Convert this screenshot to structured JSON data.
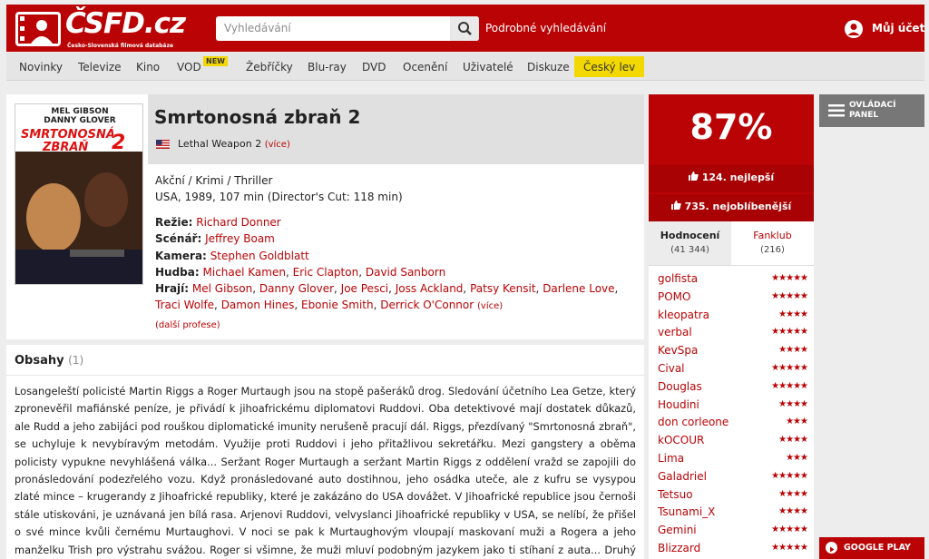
{
  "header": {
    "logo_text": "ČSFD.cz",
    "logo_sub": "Česko-Slovenská filmová databáze",
    "search_placeholder": "Vyhledávání",
    "advanced_search": "Podrobné vyhledávání",
    "account": "Můj účet"
  },
  "nav": {
    "items": [
      "Novinky",
      "Televize",
      "Kino",
      "VOD",
      "Žebříčky",
      "Blu-ray",
      "DVD",
      "Ocenění",
      "Uživatelé",
      "Diskuze",
      "Český lev"
    ],
    "vod_badge": "NEW"
  },
  "film": {
    "title": "Smrtonosná zbraň 2",
    "original_title": "Lethal Weapon 2",
    "more": "(více)",
    "genres": "Akční / Krimi / Thriller",
    "origin": "USA, 1989, 107 min (Director's Cut: 118 min)",
    "poster_actors_1": "MEL GIBSON",
    "poster_actors_2": "DANNY GLOVER",
    "poster_title_1": "SMRTONOSNÁ",
    "poster_title_2": "ZBRAŇ",
    "poster_num": "2",
    "crew": {
      "director_label": "Režie:",
      "director": "Richard Donner",
      "writer_label": "Scénář:",
      "writer": "Jeffrey Boam",
      "camera_label": "Kamera:",
      "camera": "Stephen Goldblatt",
      "music_label": "Hudba:",
      "music": [
        "Michael Kamen",
        "Eric Clapton",
        "David Sanborn"
      ],
      "cast_label": "Hrají:",
      "cast": [
        "Mel Gibson",
        "Danny Glover",
        "Joe Pesci",
        "Joss Ackland",
        "Patsy Kensit",
        "Darlene Love",
        "Traci Wolfe",
        "Damon Hines",
        "Ebonie Smith",
        "Derrick O'Connor"
      ],
      "cast_more": "(více)",
      "more_professions": "(další profese)"
    }
  },
  "plot": {
    "heading": "Obsahy",
    "count": "(1)",
    "text": "Losangeleští policisté Martin Riggs a Roger Murtaugh jsou na stopě pašeráků drog. Sledování účetního Lea Getze, který zpronevěřil mafiánské peníze, je přivádí k jihoafrickému diplomatovi Ruddovi. Oba detektivové mají dostatek důkazů, ale Rudd a jeho zabijáci pod rouškou diplomatické imunity nerušeně pracují dál. Riggs, přezdívaný \"Smrtonosná zbraň\", se uchyluje k nevybíravým metodám. Využije proti Ruddovi i jeho přitažlivou sekretářku. Mezi gangstery a oběma policisty vypukne nevyhlášená válka... Seržant Roger Murtaugh a seržant Martin Riggs z oddělení vražd se zapojili do pronásledování podezřelého vozu. Když pronásledované auto dostihnou, jeho osádka uteče, ale z kufru se vysypou zlaté mince – krugerandy z Jihoafrické republiky, které je zakázáno do USA dovážet. V Jihoafrické republice jsou černoši stále utiskováni, je uznávaná jen bílá rasa. Arjenovi Ruddovi, velvyslanci Jihoafrické republiky v USA, se nelíbí, že přišel o své mince kvůli černému Murtaughovi. V noci se pak k Murtaughovým vloupají maskovaní muži a Rogera a jeho manželku Trish pro výstrahu svážou. Roger si všimne, že muži mluví podobným jazykem jako ti stíhaní z auta... Druhý den rozhodne kapitán Ed Murphy, že Murtaugh s Riggsem budou ochraňovat korunního"
  },
  "rating": {
    "percent": "87%",
    "best_rank": "124. nejlepší",
    "popular_rank": "735. nejoblíbenější",
    "tab_ratings": "Hodnocení",
    "tab_ratings_count": "(41 344)",
    "tab_fanclub": "Fanklub",
    "tab_fanclub_count": "(216)"
  },
  "user_ratings": [
    {
      "name": "golfista",
      "stars": 5
    },
    {
      "name": "POMO",
      "stars": 5
    },
    {
      "name": "kleopatra",
      "stars": 4
    },
    {
      "name": "verbal",
      "stars": 5
    },
    {
      "name": "KevSpa",
      "stars": 4
    },
    {
      "name": "Cival",
      "stars": 5
    },
    {
      "name": "Douglas",
      "stars": 5
    },
    {
      "name": "Houdini",
      "stars": 4
    },
    {
      "name": "don corleone",
      "stars": 3
    },
    {
      "name": "kOCOUR",
      "stars": 4
    },
    {
      "name": "Lima",
      "stars": 3
    },
    {
      "name": "Galadriel",
      "stars": 5
    },
    {
      "name": "Tetsuo",
      "stars": 4
    },
    {
      "name": "Tsunami_X",
      "stars": 4
    },
    {
      "name": "Gemini",
      "stars": 5
    },
    {
      "name": "Blizzard",
      "stars": 5
    }
  ],
  "side": {
    "panel_label_1": "OVLÁDACÍ",
    "panel_label_2": "PANEL",
    "google_play": "GOOGLE PLAY"
  },
  "colors": {
    "brand": "#ba0305",
    "highlight": "#f3d800"
  }
}
